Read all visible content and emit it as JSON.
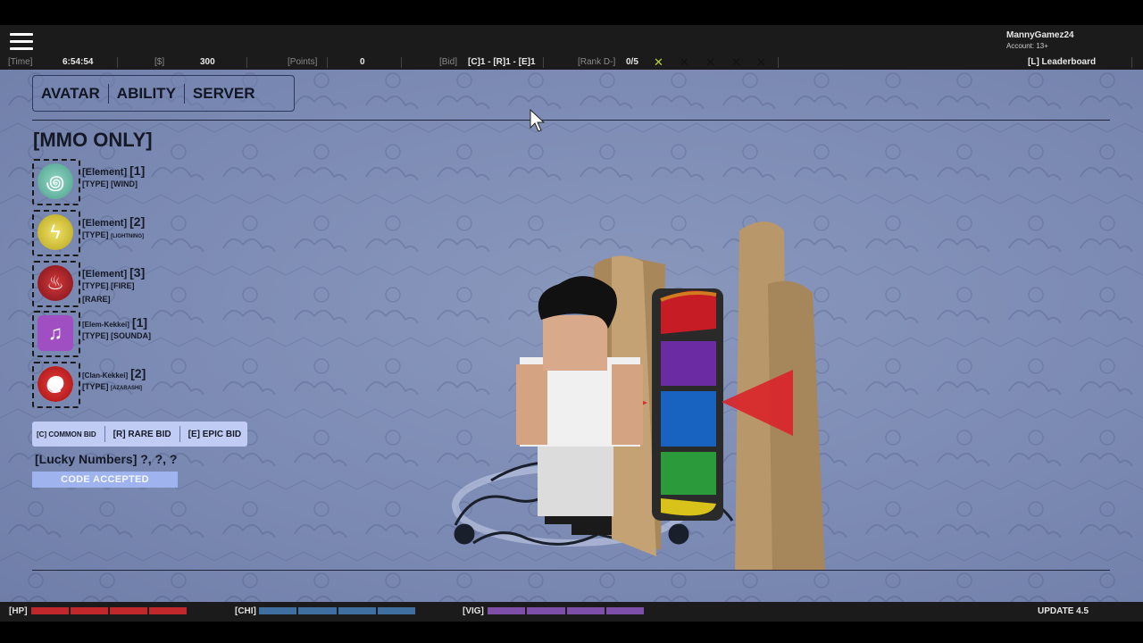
{
  "account": {
    "name": "MannyGamez24",
    "age": "Account: 13+"
  },
  "stats": {
    "time_label": "[Time]",
    "time_value": "6:54:54",
    "money_label": "[$]",
    "money_value": "300",
    "points_label": "[Points]",
    "points_value": "0",
    "bid_label": "[Bid]",
    "bid_value": "[C]1 - [R]1 - [E]1",
    "rank_label": "[Rank D-]",
    "rank_value": "0/5",
    "leaderboard": "[L] Leaderboard"
  },
  "tabs": [
    "AVATAR",
    "ABILITY",
    "SERVER"
  ],
  "heading": "[MMO ONLY]",
  "slots": [
    {
      "category": "[Element]",
      "number": "[1]",
      "type_label": "[TYPE]",
      "type_value": "[WIND]",
      "icon": "wind-icon",
      "color": "#5fb7a0"
    },
    {
      "category": "[Element]",
      "number": "[2]",
      "type_label": "[TYPE]",
      "type_value": "[LIGHTNING]",
      "icon": "lightning-icon",
      "color": "#c9b823"
    },
    {
      "category": "[Element]",
      "number": "[3]",
      "type_label": "[TYPE]",
      "type_value": "[FIRE]",
      "extra": "[RARE]",
      "icon": "fire-icon",
      "color": "#a3202a"
    },
    {
      "category": "[Elem-Kekkei]",
      "number": "[1]",
      "type_label": "[TYPE]",
      "type_value": "[SOUNDA]",
      "icon": "music-note-icon",
      "color": "#9a48b8"
    },
    {
      "category": "[Clan-Kekkei]",
      "number": "[2]",
      "type_label": "[TYPE]",
      "type_value": "[AZARASHI]",
      "icon": "spiral-icon",
      "color": "#cc2b2b"
    }
  ],
  "bids": {
    "common": "[C] COMMON BID",
    "rare": "[R] RARE BID",
    "epic": "[E] EPIC BID"
  },
  "lucky": {
    "label": "[Lucky Numbers]",
    "values": "?, ?, ?"
  },
  "code_button": "CODE ACCEPTED",
  "hud": {
    "hp_label": "[HP]",
    "chi_label": "[CHI]",
    "vig_label": "[VIG]",
    "update": "UPDATE 4.5",
    "hp_color": "#c0282c",
    "chi_color": "#3f6fa0",
    "vig_color": "#7e4fa8"
  },
  "colors": {
    "background": "#7b8ab3",
    "check": "#b5d33a",
    "cross": "#111111"
  }
}
